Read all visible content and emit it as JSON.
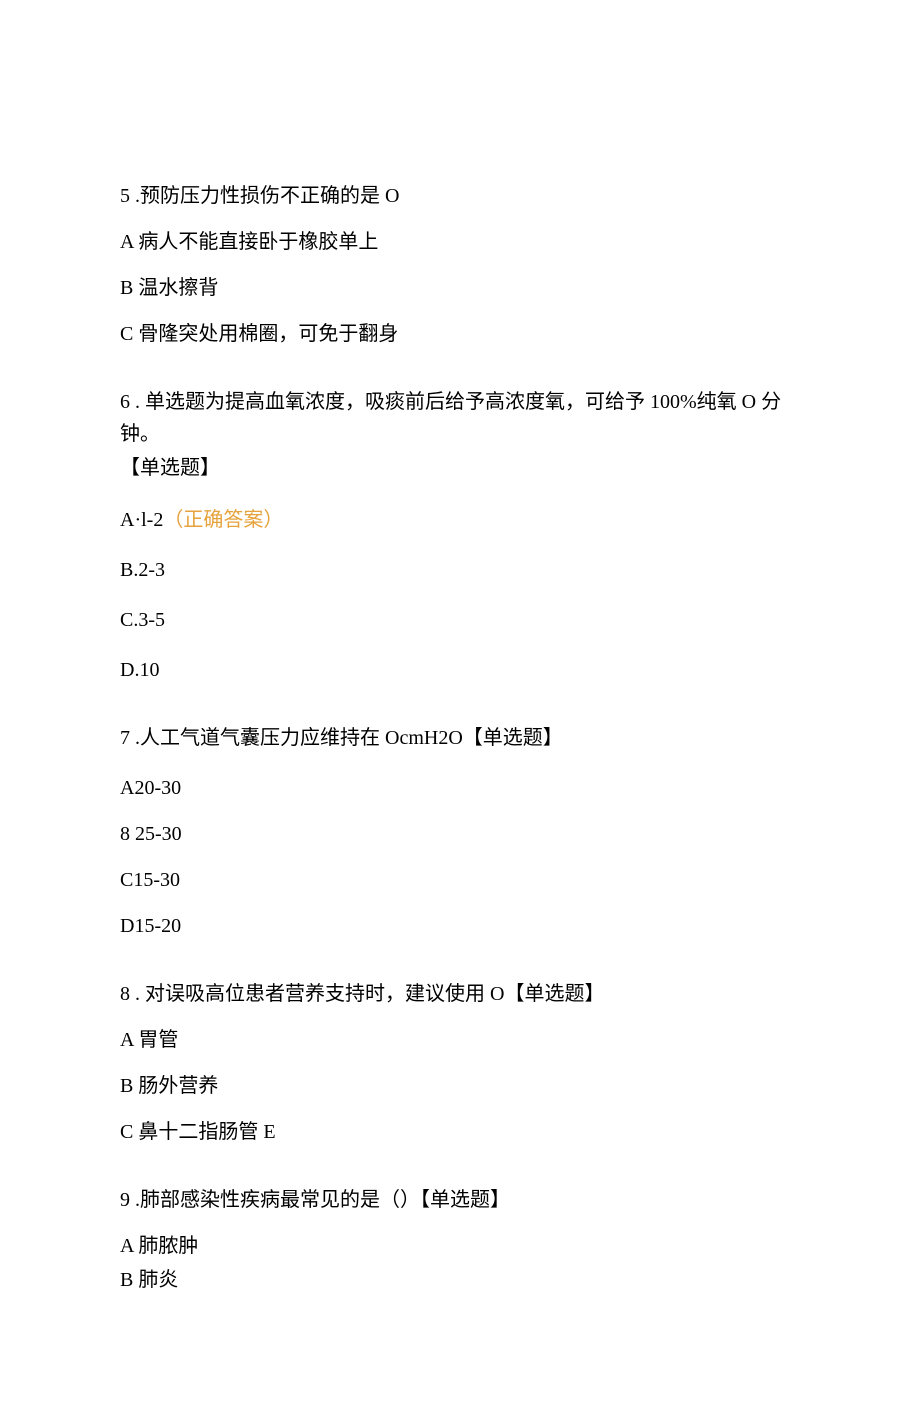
{
  "q5": {
    "number": "5",
    "stem": " .预防压力性损伤不正确的是 O",
    "optA": "A 病人不能直接卧于橡胶单上",
    "optB": "B 温水擦背",
    "optC": "C 骨隆突处用棉圈，可免于翻身"
  },
  "q6": {
    "number": "6",
    "stem": " . 单选题为提高血氧浓度，吸痰前后给予高浓度氧，可给予 100%纯氧 O 分钟。",
    "tag": "【单选题】",
    "optA_pre": "A·l-2",
    "optA_correct": "（正确答案）",
    "optB": "B.2-3",
    "optC": "C.3-5",
    "optD": "D.10"
  },
  "q7": {
    "number": "7",
    "stem": " .人工气道气囊压力应维持在 OcmH2O【单选题】",
    "optA": "A20-30",
    "optB_num": "8",
    "optB_text": "   25-30",
    "optC": "C15-30",
    "optD": "D15-20"
  },
  "q8": {
    "number": "8",
    "stem": " . 对误吸高位患者营养支持时，建议使用 O【单选题】",
    "optA": "A 胃管",
    "optB": "B 肠外营养",
    "optC": "C 鼻十二指肠管 E"
  },
  "q9": {
    "number": "9",
    "stem": " .肺部感染性疾病最常见的是（）【单选题】",
    "optA": "A 肺脓肿",
    "optB": "B 肺炎"
  }
}
